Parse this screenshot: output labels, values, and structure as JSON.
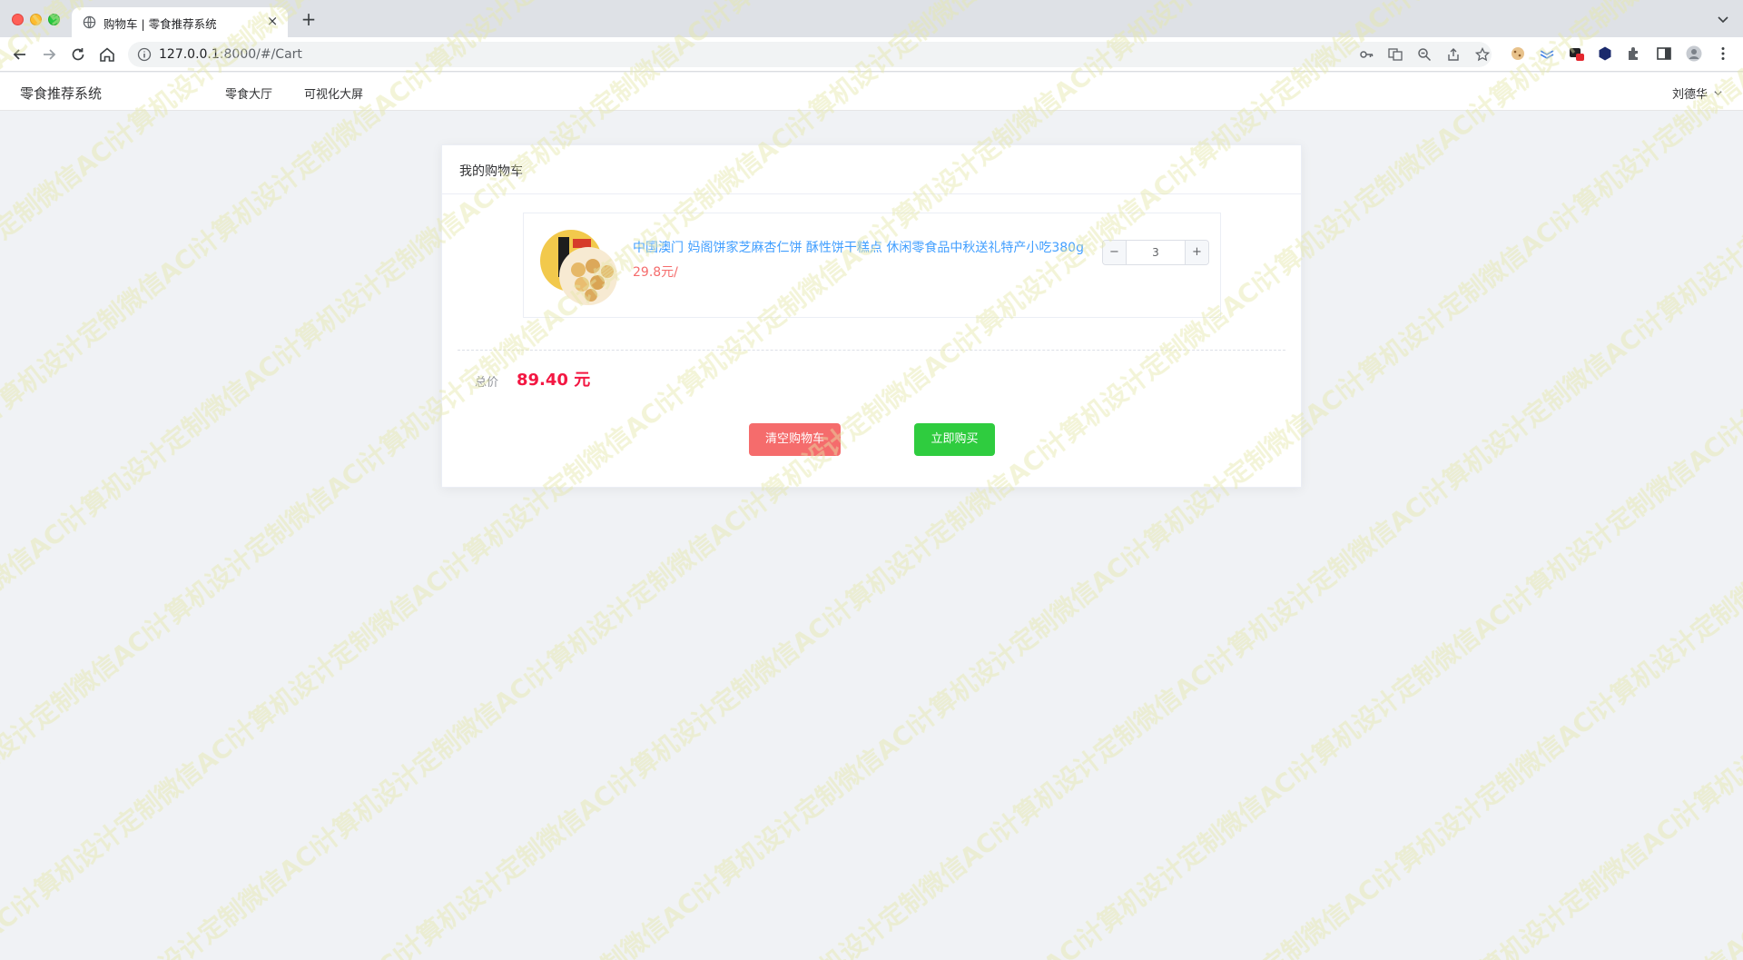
{
  "browser": {
    "tab_title": "购物车 | 零食推荐系统",
    "new_tab": "+",
    "url_host": "127.0.0.1",
    "url_rest": ":8000/#/Cart"
  },
  "app": {
    "logo": "零食推荐系统",
    "nav": [
      "零食大厅",
      "可视化大屏"
    ],
    "user": "刘德华"
  },
  "cart": {
    "header": "我的购物车",
    "items": [
      {
        "title": "中国澳门 妈阁饼家芝麻杏仁饼 酥性饼干糕点 休闲零食品中秋送礼特产小吃380g",
        "price": "29.8元/",
        "quantity": "3"
      }
    ],
    "total_label": "总价",
    "total_value": "89.40 元",
    "clear_button": "清空购物车",
    "buy_button": "立即购买"
  },
  "watermark": "计算机设计定制微信ACE2487",
  "colors": {
    "link": "#409eff",
    "price": "#f56c6c",
    "total": "#f31742",
    "clear": "#f56c6c",
    "buy": "#2fcc3f",
    "background": "#f0f2f5"
  }
}
